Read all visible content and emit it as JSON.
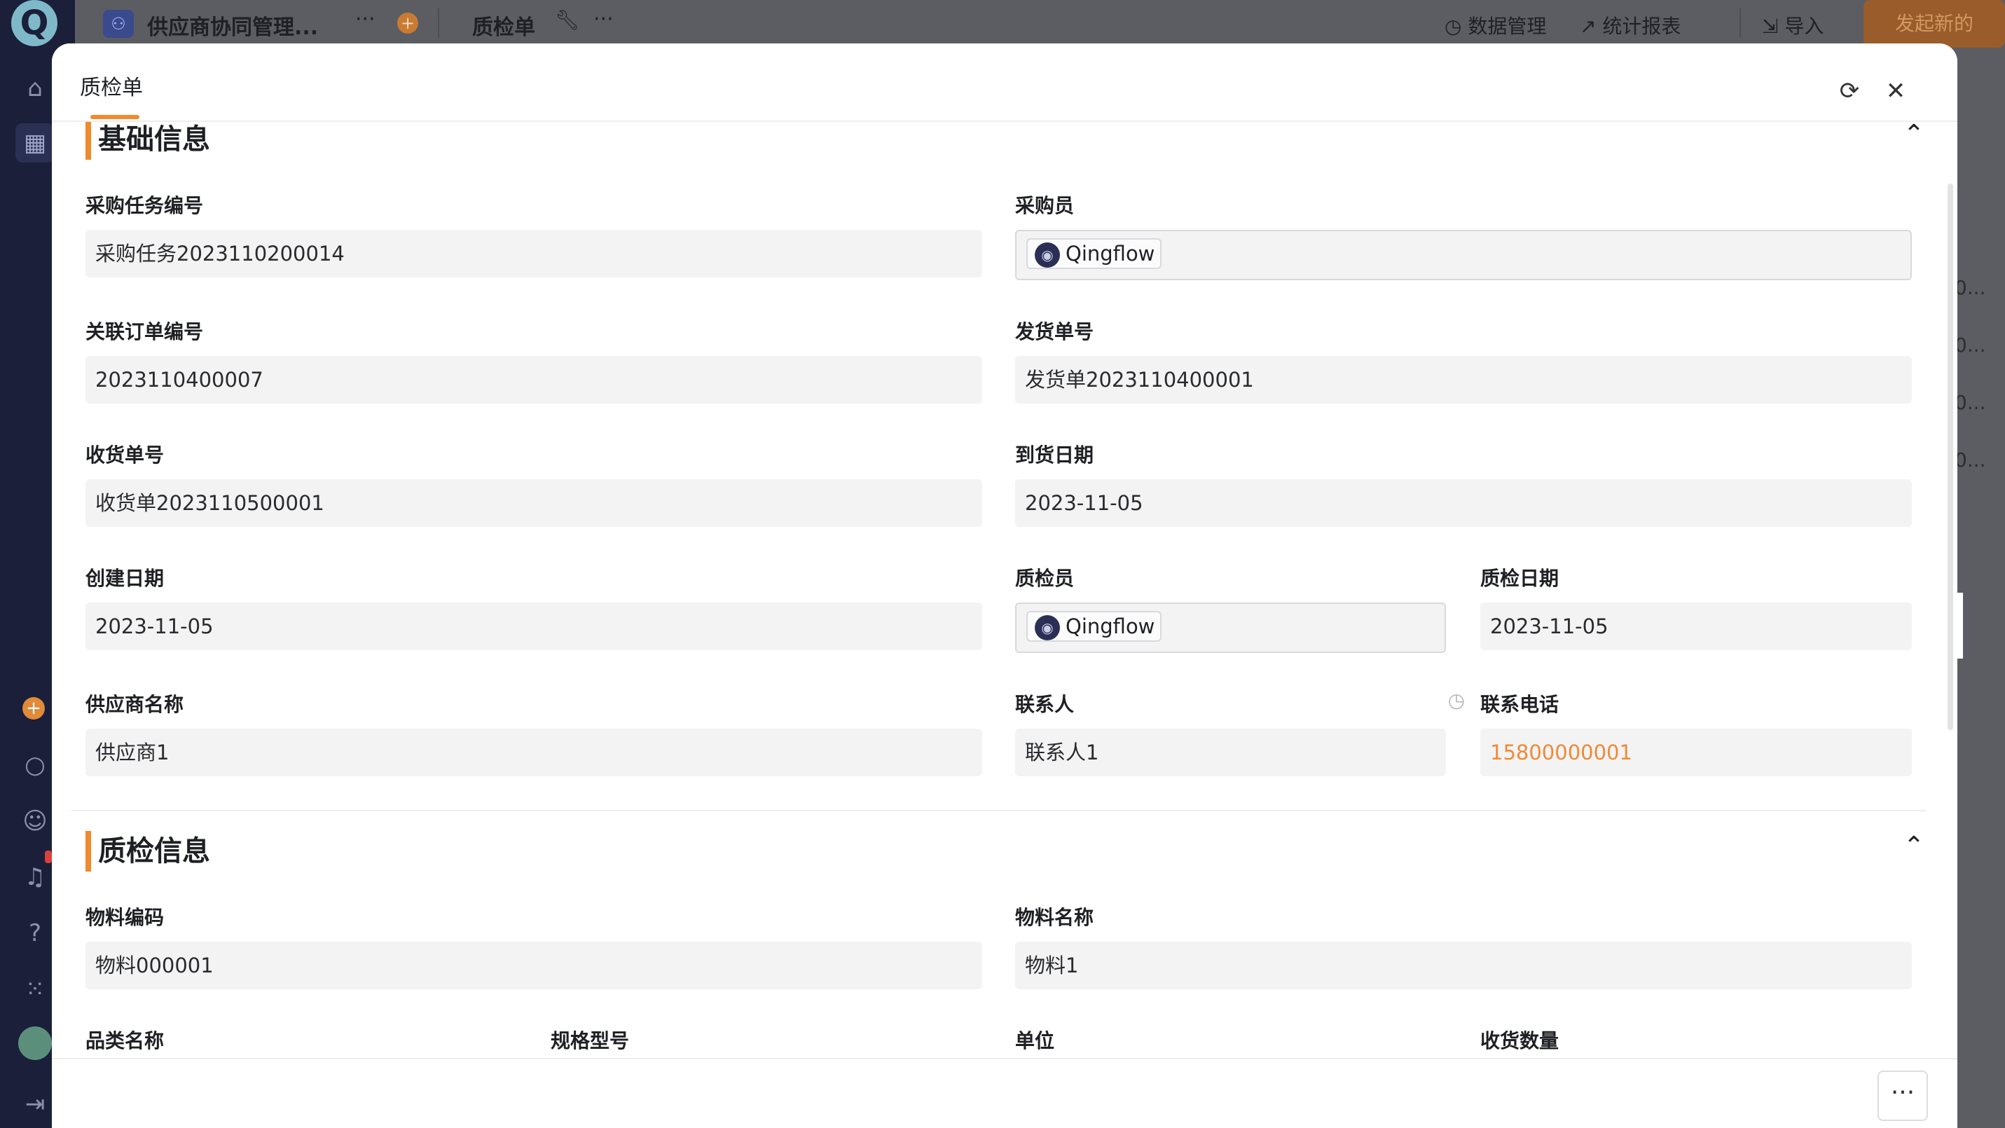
{
  "topbar": {
    "app_name": "供应商协同管理...",
    "form_name": "质检单",
    "more": "···",
    "data_mgmt": "数据管理",
    "stats": "统计报表",
    "import": "导入",
    "new_button": "发起新的"
  },
  "background_cells": [
    "0...",
    "0...",
    "0...",
    "0..."
  ],
  "modal": {
    "title": "质检单",
    "icons": {
      "refresh": "refresh-icon",
      "close": "close-icon",
      "collapse": "chevron-up-icon",
      "more": "ellipsis-icon"
    },
    "more_button": "···",
    "sections": {
      "basic": {
        "title": "基础信息",
        "fields": {
          "task_no": {
            "label": "采购任务编号",
            "value": "采购任务2023110200014"
          },
          "buyer": {
            "label": "采购员",
            "value": "Qingflow"
          },
          "order_no": {
            "label": "关联订单编号",
            "value": "2023110400007"
          },
          "ship_no": {
            "label": "发货单号",
            "value": "发货单2023110400001"
          },
          "receipt_no": {
            "label": "收货单号",
            "value": "收货单2023110500001"
          },
          "arrival_date": {
            "label": "到货日期",
            "value": "2023-11-05"
          },
          "created_date": {
            "label": "创建日期",
            "value": "2023-11-05"
          },
          "inspector": {
            "label": "质检员",
            "value": "Qingflow"
          },
          "inspect_date": {
            "label": "质检日期",
            "value": "2023-11-05"
          },
          "supplier": {
            "label": "供应商名称",
            "value": "供应商1"
          },
          "contact": {
            "label": "联系人",
            "value": "联系人1"
          },
          "phone": {
            "label": "联系电话",
            "value": "15800000001"
          }
        }
      },
      "quality": {
        "title": "质检信息",
        "fields": {
          "material_code": {
            "label": "物料编码",
            "value": "物料000001"
          },
          "material_name": {
            "label": "物料名称",
            "value": "物料1"
          },
          "category": {
            "label": "品类名称"
          },
          "spec": {
            "label": "规格型号"
          },
          "unit": {
            "label": "单位"
          },
          "qty": {
            "label": "收货数量"
          }
        }
      }
    }
  },
  "colors": {
    "accent": "#f08a2c",
    "phone": "#ef8a36",
    "field_bg": "#f3f3f4"
  }
}
